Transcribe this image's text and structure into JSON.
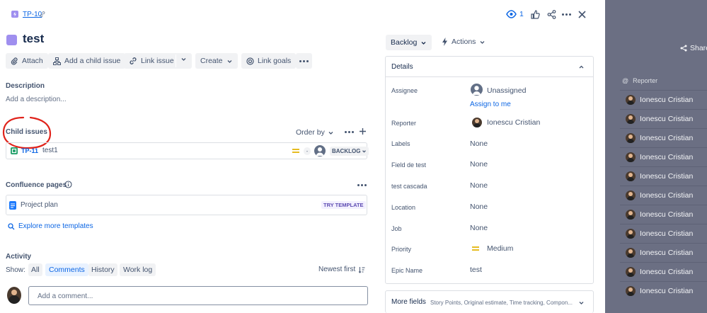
{
  "header": {
    "issue_key": "TP-10",
    "watch_count": "1"
  },
  "issue": {
    "title": "test"
  },
  "toolbar": {
    "attach": "Attach",
    "add_child": "Add a child issue",
    "link_issue": "Link issue",
    "create": "Create",
    "link_goals": "Link goals"
  },
  "description": {
    "heading": "Description",
    "placeholder": "Add a description..."
  },
  "child_issues": {
    "heading": "Child issues",
    "order_by": "Order by",
    "items": [
      {
        "key": "TP-11",
        "summary": "test1",
        "estimate": "-",
        "status": "BACKLOG"
      }
    ]
  },
  "confluence": {
    "heading": "Confluence pages",
    "page": "Project plan",
    "badge": "TRY TEMPLATE",
    "explore": "Explore more templates"
  },
  "activity": {
    "heading": "Activity",
    "show_label": "Show:",
    "filters": [
      "All",
      "Comments",
      "History",
      "Work log"
    ],
    "sort": "Newest first",
    "comment_placeholder": "Add a comment..."
  },
  "sidebar": {
    "status": "Backlog",
    "actions": "Actions",
    "details_heading": "Details",
    "fields": [
      {
        "label": "Assignee",
        "value": "Unassigned"
      },
      {
        "label": "Reporter",
        "value": "Ionescu Cristian"
      },
      {
        "label": "Labels",
        "value": "None"
      },
      {
        "label": "Field de test",
        "value": "None"
      },
      {
        "label": "test cascada",
        "value": "None"
      },
      {
        "label": "Location",
        "value": "None"
      },
      {
        "label": "Job",
        "value": "None"
      },
      {
        "label": "Priority",
        "value": "Medium"
      },
      {
        "label": "Epic Name",
        "value": "test"
      }
    ],
    "assign_to_me": "Assign to me",
    "more_fields": "More fields",
    "more_fields_hint": "Story Points, Original estimate, Time tracking, Compon..."
  },
  "background": {
    "share": "Share",
    "reporter_col": "Reporter",
    "rows": [
      "Ionescu Cristian",
      "Ionescu Cristian",
      "Ionescu Cristian",
      "Ionescu Cristian",
      "Ionescu Cristian",
      "Ionescu Cristian",
      "Ionescu Cristian",
      "Ionescu Cristian",
      "Ionescu Cristian",
      "Ionescu Cristian",
      "Ionescu Cristian"
    ]
  },
  "colors": {
    "accent": "#0c66e4",
    "epic": "#9f8fef",
    "subtask": "#22a06b",
    "annotation": "#e0231b"
  }
}
